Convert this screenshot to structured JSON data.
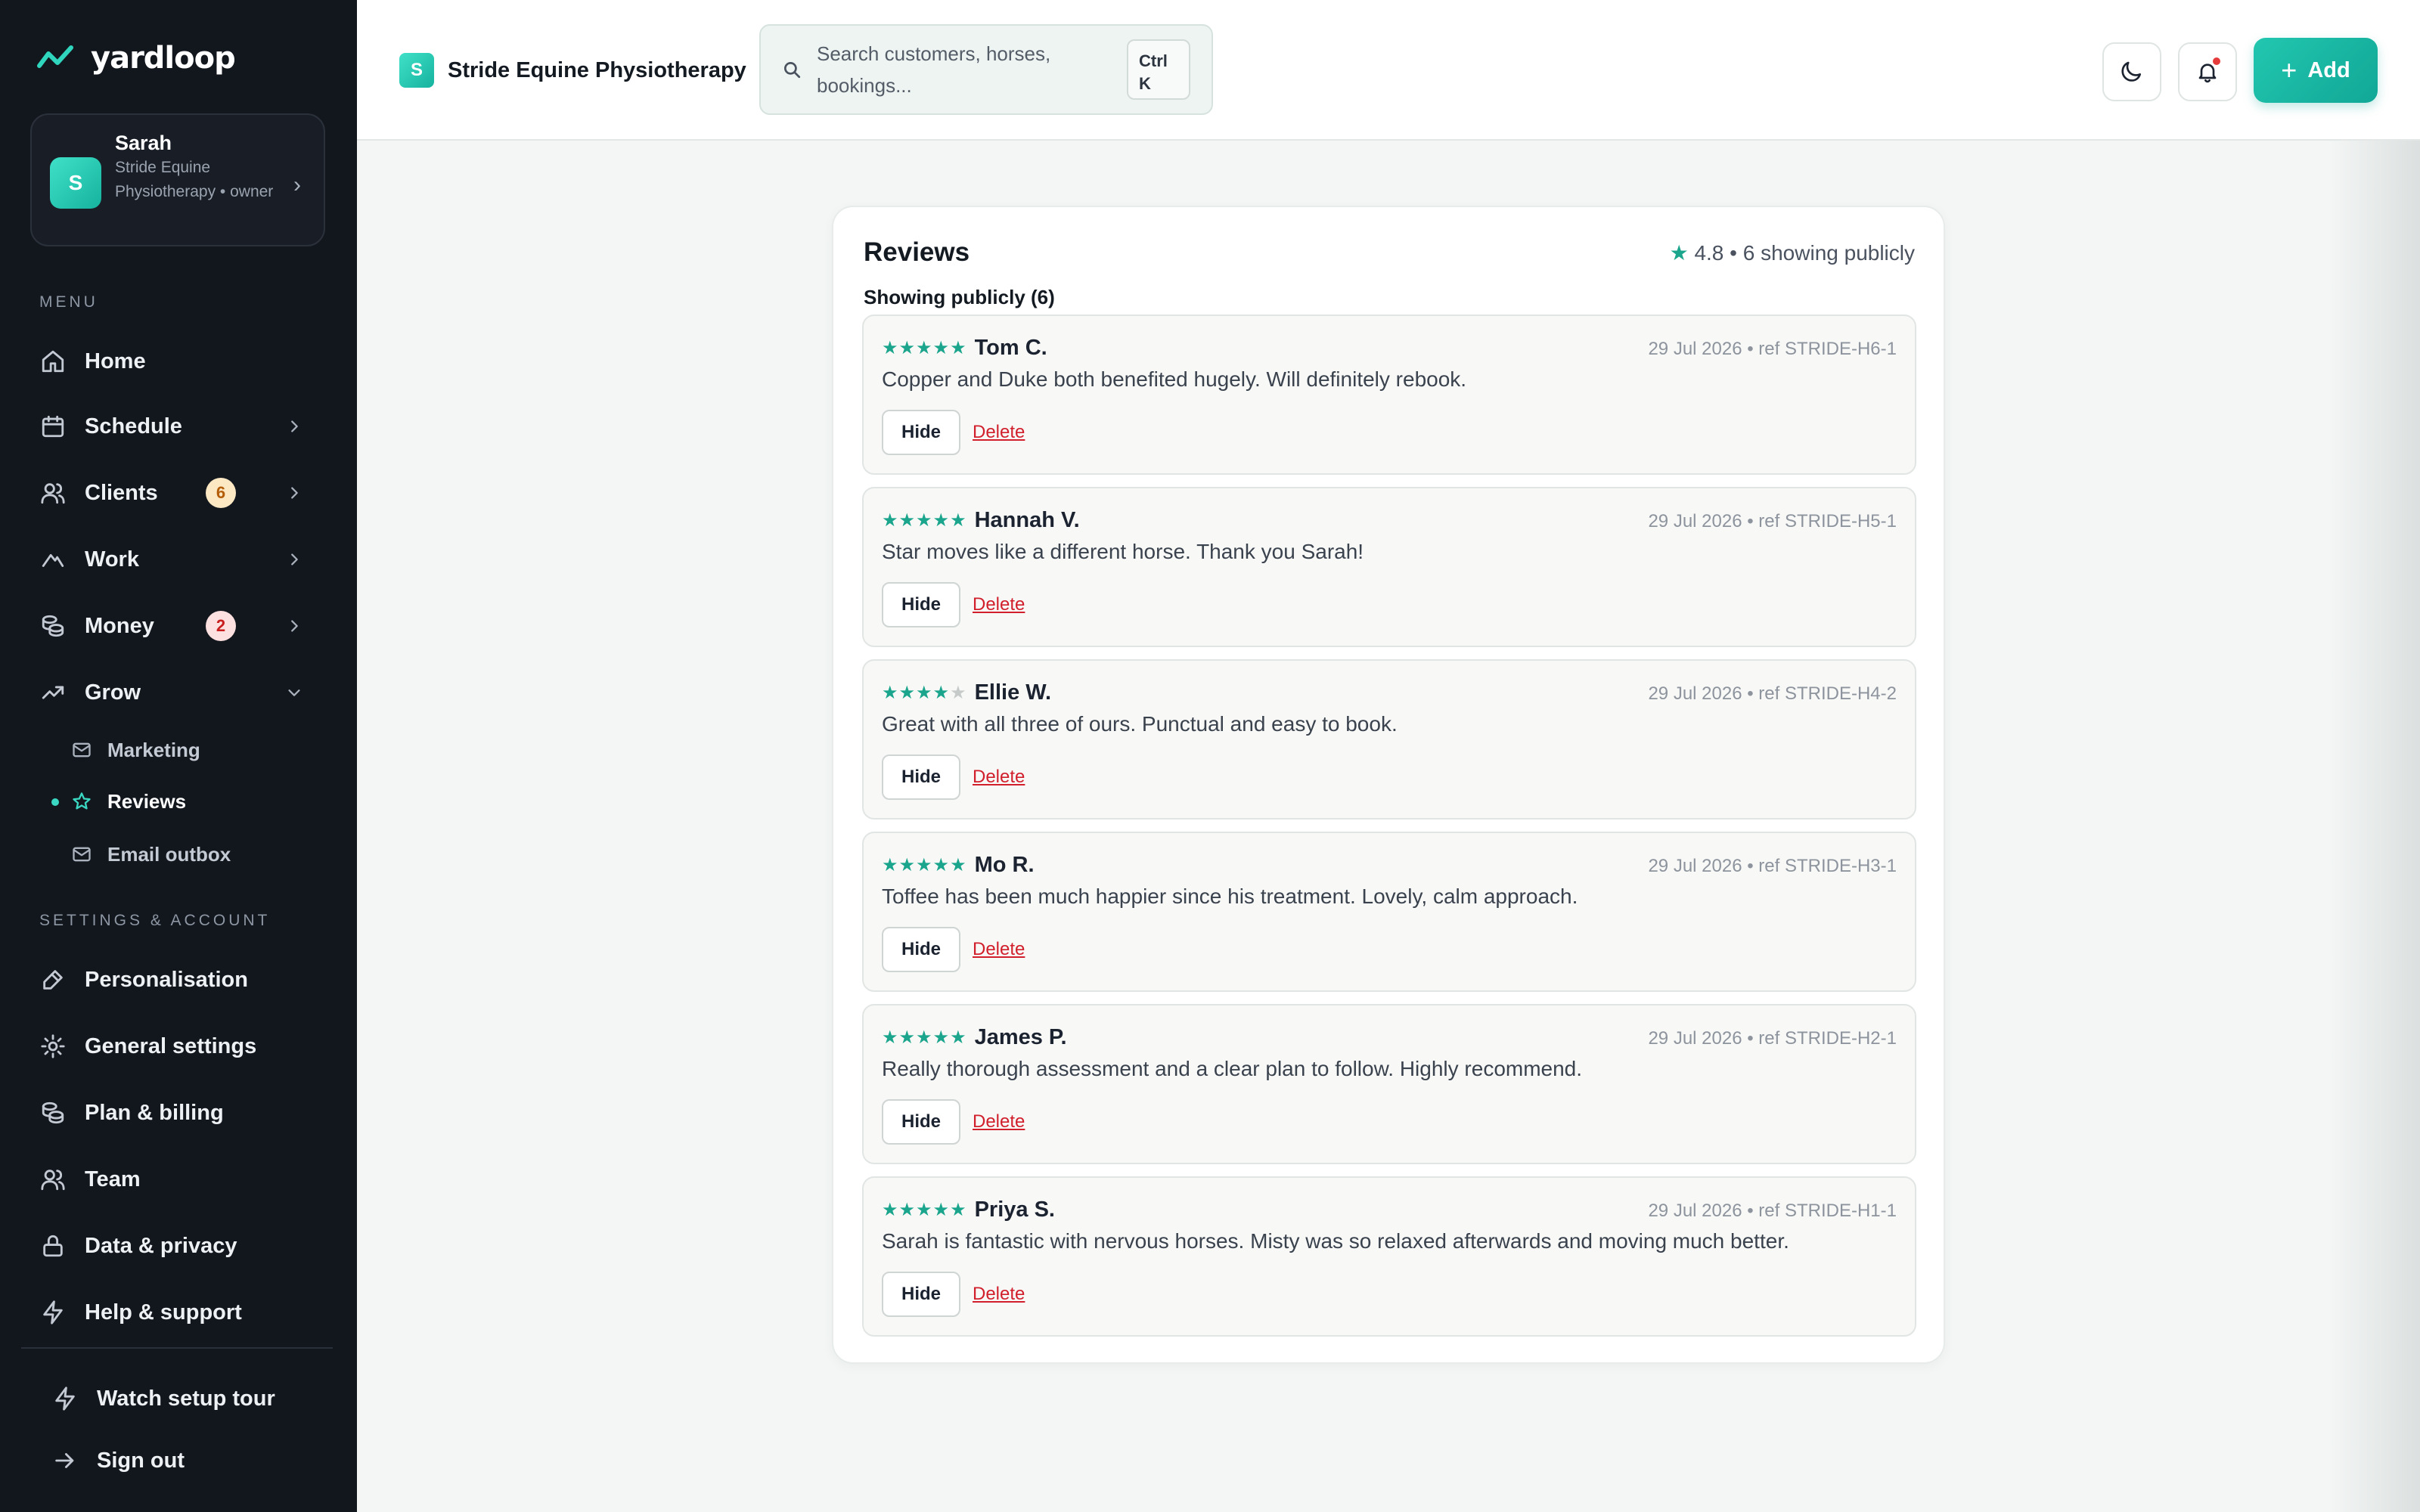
{
  "brand": {
    "name": "yardloop"
  },
  "account": {
    "name": "Sarah",
    "subtitle": "Stride Equine Physiotherapy • owner",
    "initial": "S"
  },
  "sidebar": {
    "menu_label": "MENU",
    "items": [
      {
        "label": "Home",
        "icon": "home-icon"
      },
      {
        "label": "Schedule",
        "icon": "calendar-icon"
      },
      {
        "label": "Clients",
        "icon": "users-icon",
        "badge": "6"
      },
      {
        "label": "Work",
        "icon": "work-icon"
      },
      {
        "label": "Money",
        "icon": "money-icon",
        "badge": "2"
      },
      {
        "label": "Grow",
        "icon": "trending-up-icon"
      }
    ],
    "grow_sub": [
      {
        "label": "Marketing",
        "icon": "mail-icon"
      },
      {
        "label": "Reviews",
        "icon": "star-icon",
        "active": true
      },
      {
        "label": "Email outbox",
        "icon": "mail-icon"
      }
    ],
    "settings_label": "SETTINGS & ACCOUNT",
    "settings_items": [
      {
        "label": "Personalisation",
        "icon": "brush-icon"
      },
      {
        "label": "General settings",
        "icon": "gear-icon"
      },
      {
        "label": "Plan & billing",
        "icon": "billing-icon"
      },
      {
        "label": "Team",
        "icon": "team-icon"
      },
      {
        "label": "Data & privacy",
        "icon": "lock-icon"
      },
      {
        "label": "Help & support",
        "icon": "bolt-icon"
      }
    ],
    "footer_items": [
      {
        "label": "Watch setup tour",
        "icon": "bolt-icon"
      },
      {
        "label": "Sign out",
        "icon": "arrow-right-icon"
      }
    ]
  },
  "header": {
    "business_initial": "S",
    "business_name": "Stride Equine Physiotherapy",
    "search_placeholder": "Search customers, horses, bookings...",
    "shortcut": "Ctrl K",
    "add_label": "Add"
  },
  "reviews": {
    "title": "Reviews",
    "rating": "4.8",
    "summary_suffix": "• 6 showing publicly",
    "section_heading": "Showing publicly (6)",
    "hide_label": "Hide",
    "delete_label": "Delete",
    "items": [
      {
        "stars": 5,
        "name": "Tom C.",
        "meta": "29 Jul 2026 • ref STRIDE-H6-1",
        "text": "Copper and Duke both benefited hugely. Will definitely rebook."
      },
      {
        "stars": 5,
        "name": "Hannah V.",
        "meta": "29 Jul 2026 • ref STRIDE-H5-1",
        "text": "Star moves like a different horse. Thank you Sarah!"
      },
      {
        "stars": 4,
        "name": "Ellie W.",
        "meta": "29 Jul 2026 • ref STRIDE-H4-2",
        "text": "Great with all three of ours. Punctual and easy to book."
      },
      {
        "stars": 5,
        "name": "Mo R.",
        "meta": "29 Jul 2026 • ref STRIDE-H3-1",
        "text": "Toffee has been much happier since his treatment. Lovely, calm approach."
      },
      {
        "stars": 5,
        "name": "James P.",
        "meta": "29 Jul 2026 • ref STRIDE-H2-1",
        "text": "Really thorough assessment and a clear plan to follow. Highly recommend."
      },
      {
        "stars": 5,
        "name": "Priya S.",
        "meta": "29 Jul 2026 • ref STRIDE-H1-1",
        "text": "Sarah is fantastic with nervous horses. Misty was so relaxed afterwards and moving much better."
      }
    ]
  },
  "colors": {
    "accent": "#1aa58c",
    "sidebar_bg": "#12161d",
    "danger": "#d11f2c"
  }
}
